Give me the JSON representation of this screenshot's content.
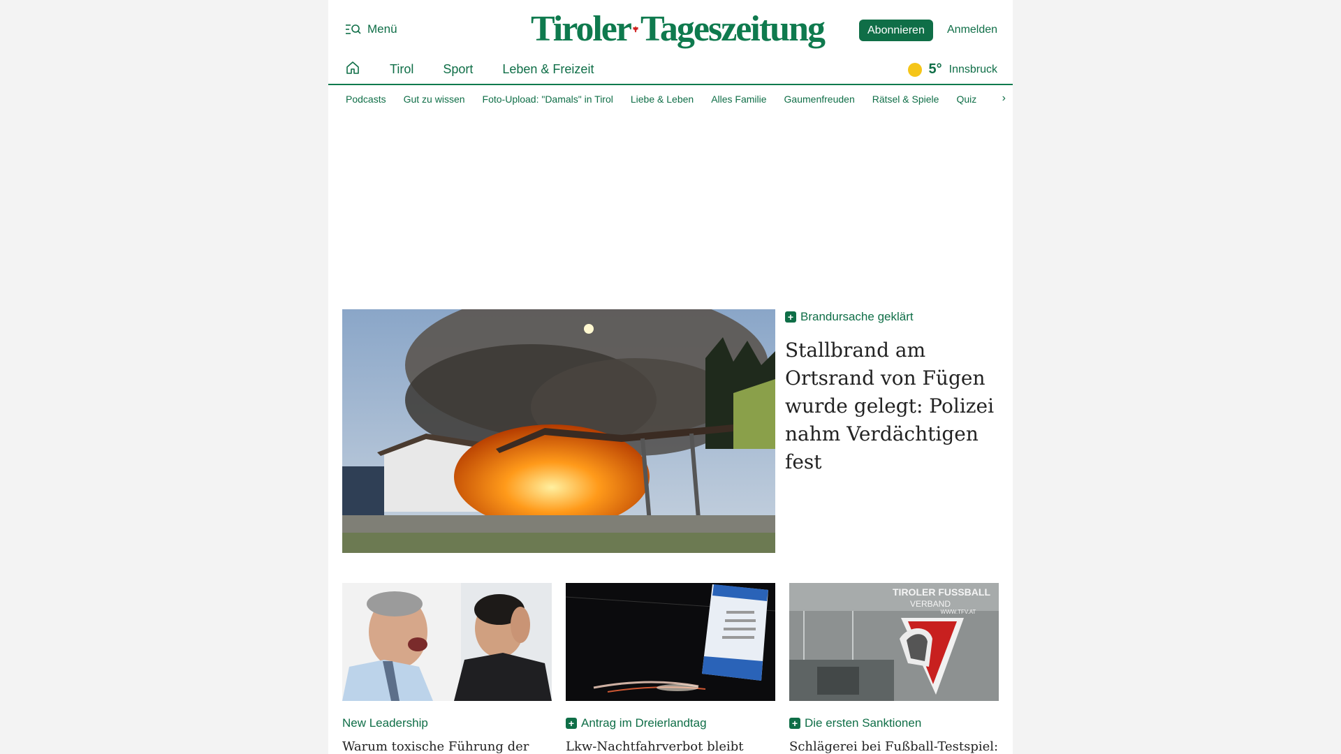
{
  "header": {
    "menu_label": "Menü",
    "logo_left": "Tiroler",
    "logo_right": "Tageszeitung",
    "subscribe_label": "Abonnieren",
    "login_label": "Anmelden"
  },
  "nav": {
    "items": [
      "Tirol",
      "Sport",
      "Leben & Freizeit"
    ]
  },
  "weather": {
    "temperature": "5°",
    "city": "Innsbruck",
    "icon": "sun-icon"
  },
  "subnav": {
    "items": [
      "Podcasts",
      "Gut zu wissen",
      "Foto-Upload: \"Damals\" in Tirol",
      "Liebe & Leben",
      "Alles Familie",
      "Gaumenfreuden",
      "Rätsel & Spiele",
      "Quiz"
    ]
  },
  "lead": {
    "kicker": "Brandursache geklärt",
    "title": "Stallbrand am Ortsrand von Fügen wurde gelegt: Polizei nahm Verdächtigen fest"
  },
  "cards": [
    {
      "kicker": "New Leadership",
      "has_plus": false,
      "title": "Warum toxische Führung der"
    },
    {
      "kicker": "Antrag im Dreierlandtag",
      "has_plus": true,
      "title": "Lkw-Nachtfahrverbot bleibt"
    },
    {
      "kicker": "Die ersten Sanktionen",
      "has_plus": true,
      "title": "Schlägerei bei Fußball-Testspiel:"
    }
  ],
  "card3_image_text": {
    "line1": "TIROLER FUSSBALL",
    "line2": "VERBAND",
    "line3": "WWW.TFV.AT"
  },
  "colors": {
    "brand_green": "#0f6e47",
    "sun_yellow": "#f5c518"
  }
}
